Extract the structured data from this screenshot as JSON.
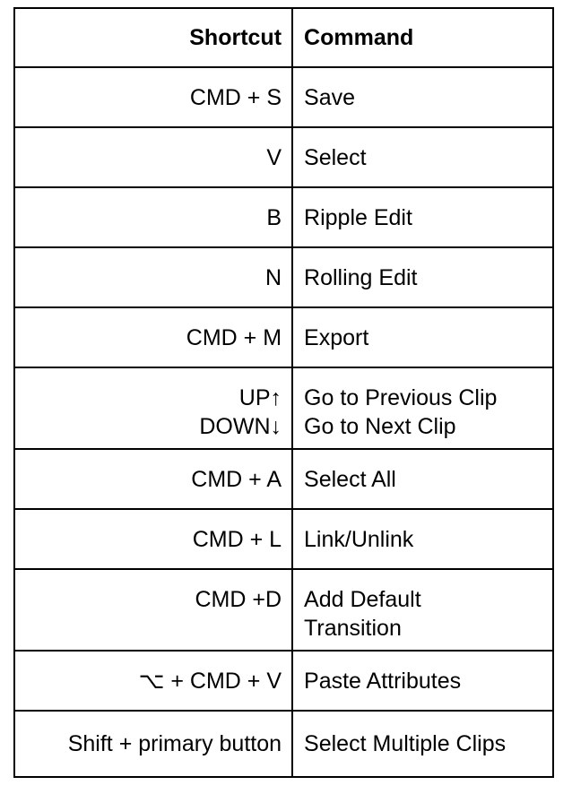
{
  "table": {
    "columns": [
      {
        "key": "shortcut",
        "label": "Shortcut",
        "align": "right"
      },
      {
        "key": "command",
        "label": "Command",
        "align": "left"
      }
    ],
    "rows": [
      {
        "shortcut": "CMD + S",
        "command": "Save",
        "lines": 1
      },
      {
        "shortcut": "V",
        "command": "Select",
        "lines": 1
      },
      {
        "shortcut": "B",
        "command": "Ripple Edit",
        "lines": 1
      },
      {
        "shortcut": "N",
        "command": "Rolling Edit",
        "lines": 1
      },
      {
        "shortcut": "CMD + M",
        "command": "Export",
        "lines": 1
      },
      {
        "shortcut": "UP↑\nDOWN↓",
        "command": "Go to Previous Clip\nGo to Next Clip",
        "lines": 2
      },
      {
        "shortcut": "CMD + A",
        "command": "Select All",
        "lines": 1
      },
      {
        "shortcut": "CMD + L",
        "command": "Link/Unlink",
        "lines": 1
      },
      {
        "shortcut": "CMD +D",
        "command": "Add Default\nTransition",
        "lines": 2
      },
      {
        "shortcut": "⌥ + CMD + V",
        "command": "Paste Attributes",
        "lines": 1
      },
      {
        "shortcut": "Shift + primary button",
        "command": "Select Multiple Clips",
        "lines": 1,
        "compact": true
      }
    ]
  },
  "style": {
    "background": "#ffffff",
    "border_color": "#000000",
    "text_color": "#000000"
  }
}
